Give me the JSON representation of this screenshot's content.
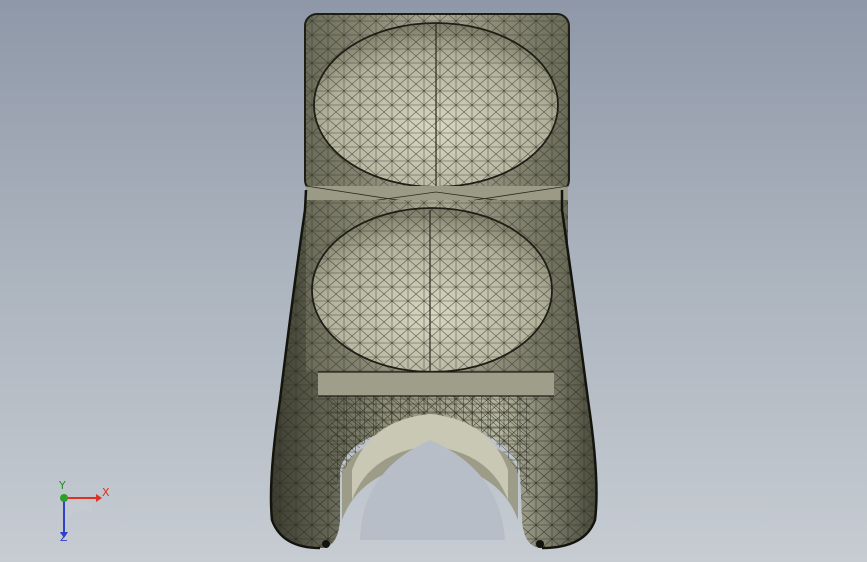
{
  "viewport": {
    "background_top": "#8f98a8",
    "background_bottom": "#c6ccd2",
    "model_fill": "#a8a894",
    "model_shadow": "#5c5c4c",
    "mesh_color": "#2a2a20"
  },
  "triad": {
    "x_label": "X",
    "y_label": "Y",
    "z_label": "Z",
    "x_color": "#e03020",
    "y_color": "#2a8a2a",
    "z_color": "#3040c8"
  }
}
